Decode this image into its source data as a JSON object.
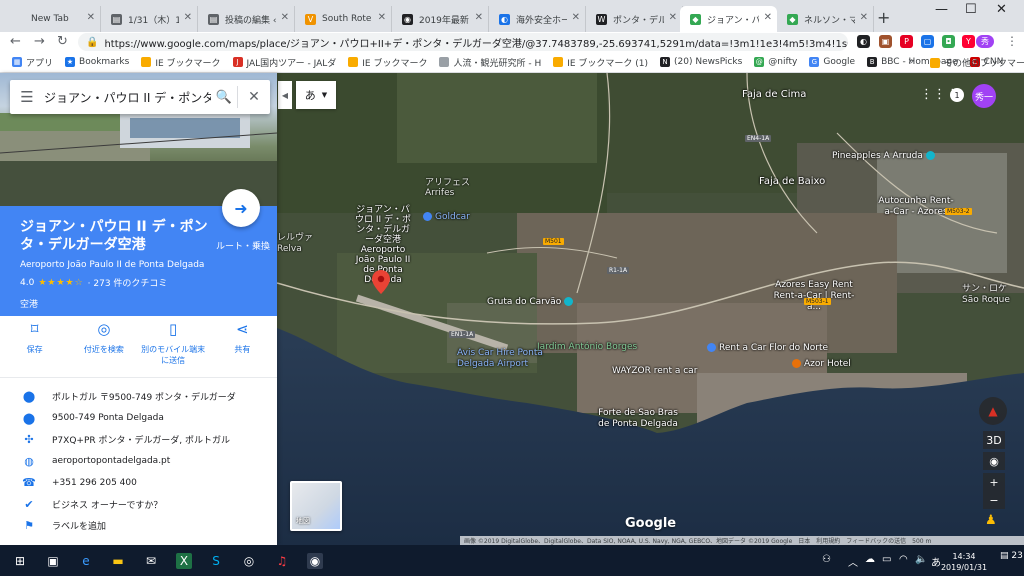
{
  "browser": {
    "tabs": [
      {
        "label": "New Tab",
        "icon": "blank-page-icon",
        "color": "#dee1e6"
      },
      {
        "label": "1/31（木）148",
        "icon": "document-icon",
        "color": "#5f6368"
      },
      {
        "label": "投稿の編集 ‹ 私",
        "icon": "document-icon",
        "color": "#5f6368"
      },
      {
        "label": "South Rote Sa",
        "icon": "yelp-icon",
        "color": "#f09300"
      },
      {
        "label": "2019年最新 モ",
        "icon": "tripadvisor-icon",
        "color": "#202124"
      },
      {
        "label": "海外安全ホーム",
        "icon": "globe-icon",
        "color": "#1a73e8"
      },
      {
        "label": "ポンタ・デルガダ",
        "icon": "wikipedia-icon",
        "color": "#202124"
      },
      {
        "label": "ジョアン・パウロ II",
        "icon": "google-maps-icon",
        "color": "#34a853",
        "active": true
      },
      {
        "label": "ネルソン・マンデ",
        "icon": "google-maps-icon",
        "color": "#34a853"
      }
    ],
    "url": "https://www.google.com/maps/place/ジョアン・パウロ+II+デ・ポンタ・デルガーダ空港/@37.7483789,-25.693741,5291m/data=!3m1!1e3!4m5!3m4!1s0x0:0x5eeb91deb9d21d7!8m2!3...",
    "bookmarks": [
      {
        "label": "アプリ",
        "icon": "apps-icon",
        "color": "#4285f4"
      },
      {
        "label": "Bookmarks",
        "icon": "star-icon",
        "color": "#1a73e8"
      },
      {
        "label": "IE ブックマーク",
        "icon": "folder-icon",
        "color": "#f9ab00"
      },
      {
        "label": "JAL国内ツアー - JALダ",
        "icon": "jal-icon",
        "color": "#d93025"
      },
      {
        "label": "IE ブックマーク",
        "icon": "folder-icon",
        "color": "#f9ab00"
      },
      {
        "label": "人流・観光研究所 - H",
        "icon": "document-icon",
        "color": "#9aa0a6"
      },
      {
        "label": "IE ブックマーク (1)",
        "icon": "folder-icon",
        "color": "#f9ab00"
      },
      {
        "label": "(20) NewsPicks",
        "icon": "newspicks-icon",
        "color": "#202124"
      },
      {
        "label": "@nifty",
        "icon": "nifty-icon",
        "color": "#34a853"
      },
      {
        "label": "Google",
        "icon": "google-icon",
        "color": "#4285f4"
      },
      {
        "label": "BBC - Homepage",
        "icon": "bbc-icon",
        "color": "#202124"
      },
      {
        "label": "CNN",
        "icon": "cnn-icon",
        "color": "#cc0000"
      }
    ],
    "bookmarks_more": "»",
    "other_bookmarks": "その他のブックマーク"
  },
  "search": {
    "query": "ジョアン・パウロ II デ・ポンタ・"
  },
  "place": {
    "title": "ジョアン・パウロ II デ・ポンタ・デルガーダ空港",
    "subtitle": "Aeroporto João Paulo II de Ponta Delgada",
    "rating": "4.0",
    "stars": "★★★★☆",
    "reviews": "· 273 件のクチコミ",
    "category": "空港",
    "directions_label": "ルート・乗換"
  },
  "actions": [
    {
      "label": "保存",
      "icon": "bookmark-icon",
      "glyph": "🔖"
    },
    {
      "label": "付近を検索",
      "icon": "nearby-icon",
      "glyph": "◎"
    },
    {
      "label": "別のモバイル端末に送信",
      "icon": "send-to-phone-icon",
      "glyph": "📱"
    },
    {
      "label": "共有",
      "icon": "share-icon",
      "glyph": "⤴"
    }
  ],
  "info": [
    {
      "text": "ポルトガル 〒9500-749 ポンタ・デルガーダ",
      "icon": "location-pin-icon",
      "glyph": "📍"
    },
    {
      "text": "9500-749 Ponta Delgada",
      "icon": "location-pin-icon",
      "glyph": "📍"
    },
    {
      "text": "P7XQ+PR ポンタ・デルガーダ, ポルトガル",
      "icon": "plus-code-icon",
      "glyph": "✣"
    },
    {
      "text": "aeroportopontadelgada.pt",
      "icon": "website-globe-icon",
      "glyph": "🌐"
    },
    {
      "text": "+351 296 205 400",
      "icon": "phone-icon",
      "glyph": "📞"
    },
    {
      "text": "ビジネス オーナーですか？",
      "icon": "verified-shield-icon",
      "glyph": "✔"
    },
    {
      "text": "ラベルを追加",
      "icon": "flag-icon",
      "glyph": "⚑"
    }
  ],
  "map": {
    "language_button": "あ",
    "notifications": "1",
    "avatar": "秀一",
    "minimap_label": "地図",
    "google_logo": "Google",
    "attribution": "画像 ©2019 DigitalGlobe、DigitalGlobe、Data SIO, NOAA, U.S. Navy, NGA, GEBCO、地図データ ©2019 Google　日本　利用規約　フィードバックの送信　500 m",
    "controls": {
      "three_d": "3D",
      "zoom_in": "+",
      "zoom_out": "−"
    },
    "labels": [
      {
        "text": "Faja de Cima",
        "type": "place"
      },
      {
        "text": "Pineapples A Arruda",
        "type": "poi"
      },
      {
        "text": "Faja de Baixo",
        "type": "place"
      },
      {
        "text": "Autocunha Rent-a-Car - Azores",
        "type": "poi"
      },
      {
        "text": "Goldcar",
        "type": "poi"
      },
      {
        "text": "アリフェス Arrifes",
        "type": "place"
      },
      {
        "text": "レルヴァ Relva",
        "type": "place"
      },
      {
        "text": "Azores Easy Rent Rent-a-Car | Rent-a...",
        "type": "poi"
      },
      {
        "text": "Gruta do Carvão",
        "type": "poi"
      },
      {
        "text": "Jardim António Borges",
        "type": "park"
      },
      {
        "text": "Rent a Car Flor do Norte",
        "type": "poi"
      },
      {
        "text": "Azor Hotel",
        "type": "poi"
      },
      {
        "text": "Avis Car Hire Ponta Delgada Airport",
        "type": "poi"
      },
      {
        "text": "WAYZOR rent a car",
        "type": "poi"
      },
      {
        "text": "Forte de Sao Bras de Ponta Delgada",
        "type": "poi"
      },
      {
        "text": "サン・ロケ São Roque",
        "type": "place"
      }
    ],
    "airport_label": "ジョアン・パウロ II デ・ポンタ・デルガーダ空港 Aeroporto João Paulo II de Ponta Delgada",
    "roads": [
      "EN1-1A",
      "M501",
      "R1-1A",
      "M503-2",
      "EN4-1A",
      "M503-1"
    ]
  },
  "taskbar": {
    "time": "14:34",
    "date": "2019/01/31",
    "notifications": "23"
  }
}
